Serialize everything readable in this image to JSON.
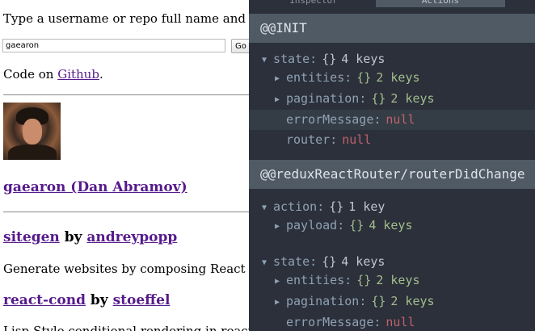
{
  "app": {
    "prompt": "Type a username or repo full name and hit 'Go':",
    "search_value": "gaearon",
    "go_label": "Go",
    "code_prefix": "Code on ",
    "code_link": "Github",
    "code_suffix": ".",
    "user_title": "gaearon (Dan Abramov)",
    "repos": [
      {
        "name": "sitegen",
        "by": "by",
        "owner": "andreypopp",
        "description": "Generate websites by composing React components"
      },
      {
        "name": "react-cond",
        "by": "by",
        "owner": "stoeffel",
        "description": "Lisp-Style conditional rendering in react."
      }
    ]
  },
  "devtools": {
    "tabs": [
      "Inspector",
      "Actions"
    ],
    "actions": [
      {
        "title": "@@INIT",
        "rows": [
          {
            "indent": 0,
            "arrow": "down",
            "key": "state",
            "brace": "{}",
            "count": "4 keys",
            "style": "dim"
          },
          {
            "indent": 1,
            "arrow": "right",
            "key": "entities",
            "brace": "{}",
            "count": "2 keys",
            "style": "green"
          },
          {
            "indent": 1,
            "arrow": "right",
            "key": "pagination",
            "brace": "{}",
            "count": "2 keys",
            "style": "green"
          },
          {
            "indent": 1,
            "key": "errorMessage",
            "value": "null",
            "highlight": true
          },
          {
            "indent": 1,
            "key": "router",
            "value": "null"
          }
        ]
      },
      {
        "title": "@@reduxReactRouter/routerDidChange",
        "rows": [
          {
            "indent": 0,
            "arrow": "down",
            "key": "action",
            "brace": "{}",
            "count": "1 key",
            "style": "dim"
          },
          {
            "indent": 1,
            "arrow": "right",
            "key": "payload",
            "brace": "{}",
            "count": "4 keys",
            "style": "green"
          },
          {
            "indent": 0,
            "arrow": "down",
            "key": "state",
            "brace": "{}",
            "count": "4 keys",
            "style": "dim"
          },
          {
            "indent": 1,
            "arrow": "right",
            "key": "entities",
            "brace": "{}",
            "count": "2 keys",
            "style": "green"
          },
          {
            "indent": 1,
            "arrow": "right",
            "key": "pagination",
            "brace": "{}",
            "count": "2 keys",
            "style": "green"
          },
          {
            "indent": 1,
            "key": "errorMessage",
            "value": "null"
          }
        ]
      }
    ]
  }
}
